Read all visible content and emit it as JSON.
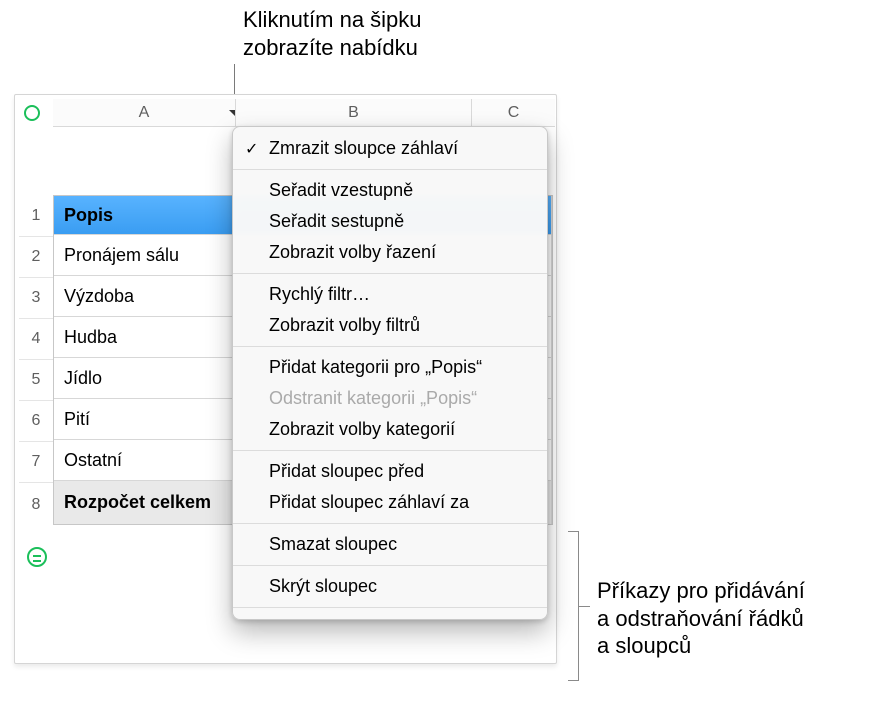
{
  "callouts": {
    "top": "Kliknutím na šipku zobrazíte nabídku",
    "top_line1": "Kliknutím na šipku",
    "top_line2": "zobrazíte nabídku",
    "right_line1": "Příkazy pro přidávání",
    "right_line2": "a odstraňování řádků",
    "right_line3": "a sloupců"
  },
  "columns": {
    "a": "A",
    "b": "B",
    "c": "C"
  },
  "row_numbers": {
    "r1": "1",
    "r2": "2",
    "r3": "3",
    "r4": "4",
    "r5": "5",
    "r6": "6",
    "r7": "7",
    "r8": "8"
  },
  "rows": {
    "header": "Popis",
    "r2": "Pronájem sálu",
    "r3": "Výzdoba",
    "r4": "Hudba",
    "r5": "Jídlo",
    "r6": "Pití",
    "r7": "Ostatní",
    "footer": "Rozpočet celkem"
  },
  "menu": {
    "freeze_header_cols": "Zmrazit sloupce záhlaví",
    "sort_asc": "Seřadit vzestupně",
    "sort_desc": "Seřadit sestupně",
    "show_sort_opts": "Zobrazit volby řazení",
    "quick_filter": "Rychlý filtr…",
    "show_filter_opts": "Zobrazit volby filtrů",
    "add_category_for": "Přidat kategorii pro „Popis“",
    "remove_category": "Odstranit kategorii „Popis“",
    "show_category_opts": "Zobrazit volby kategorií",
    "add_col_before": "Přidat sloupec před",
    "add_header_col_after": "Přidat sloupec záhlaví za",
    "delete_col": "Smazat sloupec",
    "hide_col": "Skrýt sloupec"
  }
}
